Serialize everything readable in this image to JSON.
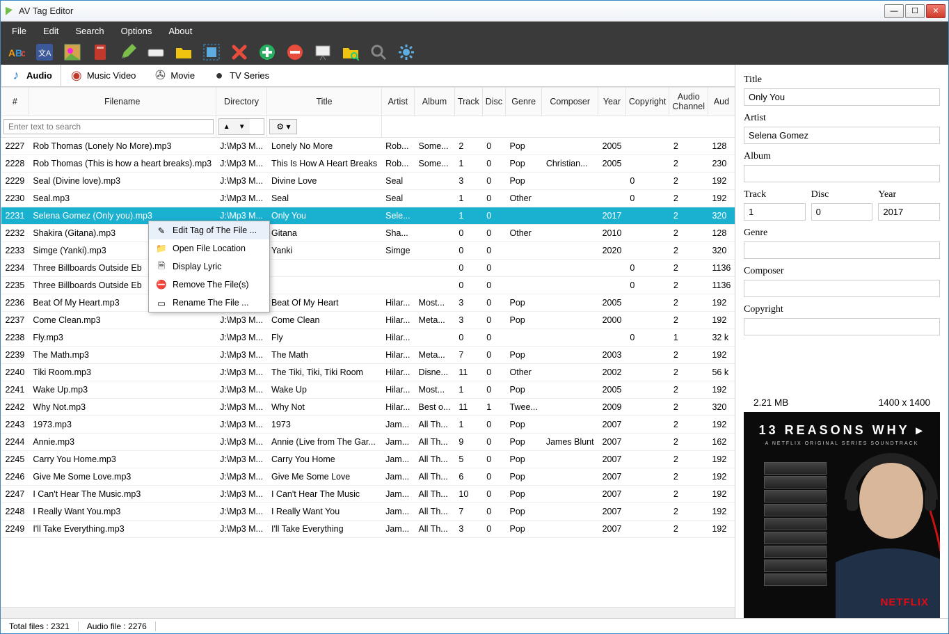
{
  "window": {
    "title": "AV Tag Editor"
  },
  "menu": [
    "File",
    "Edit",
    "Search",
    "Options",
    "About"
  ],
  "tabs": [
    {
      "label": "Audio",
      "icon": "music-note-icon",
      "active": true
    },
    {
      "label": "Music Video",
      "icon": "video-disc-icon"
    },
    {
      "label": "Movie",
      "icon": "film-reel-icon"
    },
    {
      "label": "TV Series",
      "icon": "tv-icon"
    }
  ],
  "toolbar_icons": [
    "abc",
    "xa",
    "picture",
    "book-red",
    "pencil",
    "label-blank",
    "folder",
    "select-all",
    "red-x",
    "green-plus",
    "red-stop",
    "presentation",
    "folder-search",
    "magnifier",
    "gear"
  ],
  "columns": [
    "#",
    "Filename",
    "Directory",
    "Title",
    "Artist",
    "Album",
    "Track",
    "Disc",
    "Genre",
    "Composer",
    "Year",
    "Copyright",
    "Audio Channel",
    "Aud"
  ],
  "search_placeholder": "Enter text to search",
  "rows": [
    {
      "n": "2227",
      "file": "Rob Thomas (Lonely No More).mp3",
      "dir": "J:\\Mp3 M...",
      "title": "Lonely No More",
      "artist": "Rob...",
      "album": "Some...",
      "track": "2",
      "disc": "0",
      "genre": "Pop",
      "composer": "",
      "year": "2005",
      "copyright": "",
      "channel": "2",
      "audio": "128"
    },
    {
      "n": "2228",
      "file": "Rob Thomas (This is how a heart breaks).mp3",
      "dir": "J:\\Mp3 M...",
      "title": "This Is How A Heart Breaks",
      "artist": "Rob...",
      "album": "Some...",
      "track": "1",
      "disc": "0",
      "genre": "Pop",
      "composer": "Christian...",
      "year": "2005",
      "copyright": "",
      "channel": "2",
      "audio": "230"
    },
    {
      "n": "2229",
      "file": "Seal (Divine love).mp3",
      "dir": "J:\\Mp3 M...",
      "title": "Divine Love",
      "artist": "Seal",
      "album": "",
      "track": "3",
      "disc": "0",
      "genre": "Pop",
      "composer": "",
      "year": "",
      "copyright": "0",
      "channel": "2",
      "audio": "192"
    },
    {
      "n": "2230",
      "file": "Seal.mp3",
      "dir": "J:\\Mp3 M...",
      "title": "Seal",
      "artist": "Seal",
      "album": "",
      "track": "1",
      "disc": "0",
      "genre": "Other",
      "composer": "",
      "year": "",
      "copyright": "0",
      "channel": "2",
      "audio": "192"
    },
    {
      "n": "2231",
      "file": "Selena Gomez (Only you).mp3",
      "dir": "J:\\Mp3 M...",
      "title": "Only You",
      "artist": "Sele...",
      "album": "",
      "track": "1",
      "disc": "0",
      "genre": "",
      "composer": "",
      "year": "2017",
      "copyright": "",
      "channel": "2",
      "audio": "320",
      "selected": true
    },
    {
      "n": "2232",
      "file": "Shakira (Gitana).mp3",
      "dir": "",
      "title": "Gitana",
      "artist": "Sha...",
      "album": "",
      "track": "0",
      "disc": "0",
      "genre": "Other",
      "composer": "",
      "year": "2010",
      "copyright": "",
      "channel": "2",
      "audio": "128"
    },
    {
      "n": "2233",
      "file": "Simge (Yanki).mp3",
      "dir": "",
      "title": "Yanki",
      "artist": "Simge",
      "album": "",
      "track": "0",
      "disc": "0",
      "genre": "",
      "composer": "",
      "year": "2020",
      "copyright": "",
      "channel": "2",
      "audio": "320"
    },
    {
      "n": "2234",
      "file": "Three Billboards Outside Eb",
      "dir": "",
      "title": "",
      "artist": "",
      "album": "",
      "track": "0",
      "disc": "0",
      "genre": "",
      "composer": "",
      "year": "",
      "copyright": "0",
      "channel": "2",
      "audio": "1136"
    },
    {
      "n": "2235",
      "file": "Three Billboards Outside Eb",
      "dir": "",
      "title": "",
      "artist": "",
      "album": "",
      "track": "0",
      "disc": "0",
      "genre": "",
      "composer": "",
      "year": "",
      "copyright": "0",
      "channel": "2",
      "audio": "1136"
    },
    {
      "n": "2236",
      "file": "Beat Of My Heart.mp3",
      "dir": "J:\\Mp3 M...",
      "title": "Beat Of My Heart",
      "artist": "Hilar...",
      "album": "Most...",
      "track": "3",
      "disc": "0",
      "genre": "Pop",
      "composer": "",
      "year": "2005",
      "copyright": "",
      "channel": "2",
      "audio": "192"
    },
    {
      "n": "2237",
      "file": "Come Clean.mp3",
      "dir": "J:\\Mp3 M...",
      "title": "Come Clean",
      "artist": "Hilar...",
      "album": "Meta...",
      "track": "3",
      "disc": "0",
      "genre": "Pop",
      "composer": "",
      "year": "2000",
      "copyright": "",
      "channel": "2",
      "audio": "192"
    },
    {
      "n": "2238",
      "file": "Fly.mp3",
      "dir": "J:\\Mp3 M...",
      "title": "Fly",
      "artist": "Hilar...",
      "album": "",
      "track": "0",
      "disc": "0",
      "genre": "",
      "composer": "",
      "year": "",
      "copyright": "0",
      "channel": "1",
      "audio": "32 k"
    },
    {
      "n": "2239",
      "file": "The Math.mp3",
      "dir": "J:\\Mp3 M...",
      "title": "The Math",
      "artist": "Hilar...",
      "album": "Meta...",
      "track": "7",
      "disc": "0",
      "genre": "Pop",
      "composer": "",
      "year": "2003",
      "copyright": "",
      "channel": "2",
      "audio": "192"
    },
    {
      "n": "2240",
      "file": "Tiki Room.mp3",
      "dir": "J:\\Mp3 M...",
      "title": "The Tiki, Tiki, Tiki Room",
      "artist": "Hilar...",
      "album": "Disne...",
      "track": "11",
      "disc": "0",
      "genre": "Other",
      "composer": "",
      "year": "2002",
      "copyright": "",
      "channel": "2",
      "audio": "56 k"
    },
    {
      "n": "2241",
      "file": "Wake Up.mp3",
      "dir": "J:\\Mp3 M...",
      "title": "Wake Up",
      "artist": "Hilar...",
      "album": "Most...",
      "track": "1",
      "disc": "0",
      "genre": "Pop",
      "composer": "",
      "year": "2005",
      "copyright": "",
      "channel": "2",
      "audio": "192"
    },
    {
      "n": "2242",
      "file": "Why Not.mp3",
      "dir": "J:\\Mp3 M...",
      "title": "Why Not",
      "artist": "Hilar...",
      "album": "Best o...",
      "track": "11",
      "disc": "1",
      "genre": "Twee...",
      "composer": "",
      "year": "2009",
      "copyright": "",
      "channel": "2",
      "audio": "320"
    },
    {
      "n": "2243",
      "file": "1973.mp3",
      "dir": "J:\\Mp3 M...",
      "title": "1973",
      "artist": "Jam...",
      "album": "All Th...",
      "track": "1",
      "disc": "0",
      "genre": "Pop",
      "composer": "",
      "year": "2007",
      "copyright": "",
      "channel": "2",
      "audio": "192"
    },
    {
      "n": "2244",
      "file": "Annie.mp3",
      "dir": "J:\\Mp3 M...",
      "title": "Annie (Live from The Gar...",
      "artist": "Jam...",
      "album": "All Th...",
      "track": "9",
      "disc": "0",
      "genre": "Pop",
      "composer": "James Blunt",
      "year": "2007",
      "copyright": "",
      "channel": "2",
      "audio": "162"
    },
    {
      "n": "2245",
      "file": "Carry You Home.mp3",
      "dir": "J:\\Mp3 M...",
      "title": "Carry You Home",
      "artist": "Jam...",
      "album": "All Th...",
      "track": "5",
      "disc": "0",
      "genre": "Pop",
      "composer": "",
      "year": "2007",
      "copyright": "",
      "channel": "2",
      "audio": "192"
    },
    {
      "n": "2246",
      "file": "Give Me Some Love.mp3",
      "dir": "J:\\Mp3 M...",
      "title": "Give Me Some Love",
      "artist": "Jam...",
      "album": "All Th...",
      "track": "6",
      "disc": "0",
      "genre": "Pop",
      "composer": "",
      "year": "2007",
      "copyright": "",
      "channel": "2",
      "audio": "192"
    },
    {
      "n": "2247",
      "file": "I Can't Hear The Music.mp3",
      "dir": "J:\\Mp3 M...",
      "title": "I Can't Hear The Music",
      "artist": "Jam...",
      "album": "All Th...",
      "track": "10",
      "disc": "0",
      "genre": "Pop",
      "composer": "",
      "year": "2007",
      "copyright": "",
      "channel": "2",
      "audio": "192"
    },
    {
      "n": "2248",
      "file": "I Really Want You.mp3",
      "dir": "J:\\Mp3 M...",
      "title": "I Really Want You",
      "artist": "Jam...",
      "album": "All Th...",
      "track": "7",
      "disc": "0",
      "genre": "Pop",
      "composer": "",
      "year": "2007",
      "copyright": "",
      "channel": "2",
      "audio": "192"
    },
    {
      "n": "2249",
      "file": "I'll Take Everything.mp3",
      "dir": "J:\\Mp3 M...",
      "title": "I'll Take Everything",
      "artist": "Jam...",
      "album": "All Th...",
      "track": "3",
      "disc": "0",
      "genre": "Pop",
      "composer": "",
      "year": "2007",
      "copyright": "",
      "channel": "2",
      "audio": "192"
    }
  ],
  "context_menu": [
    {
      "icon": "pencil-icon",
      "label": "Edit Tag of The File ...",
      "hl": true
    },
    {
      "icon": "folder-icon",
      "label": "Open File Location"
    },
    {
      "icon": "lyric-icon",
      "label": "Display Lyric"
    },
    {
      "icon": "remove-icon",
      "label": "Remove The File(s)"
    },
    {
      "icon": "rename-icon",
      "label": "Rename The File ..."
    }
  ],
  "detail": {
    "title_label": "Title",
    "title": "Only You",
    "artist_label": "Artist",
    "artist": "Selena Gomez",
    "album_label": "Album",
    "album": "",
    "track_label": "Track",
    "track": "1",
    "disc_label": "Disc",
    "disc": "0",
    "year_label": "Year",
    "year": "2017",
    "genre_label": "Genre",
    "genre": "",
    "composer_label": "Composer",
    "composer": "",
    "copyright_label": "Copyright",
    "copyright": "",
    "size": "2.21 MB",
    "dimensions": "1400 x 1400",
    "art_title": "13 REASONS WHY ▸",
    "art_sub": "A NETFLIX ORIGINAL SERIES SOUNDTRACK",
    "art_brand": "NETFLIX"
  },
  "status": {
    "total": "Total files : 2321",
    "audio": "Audio file : 2276"
  }
}
